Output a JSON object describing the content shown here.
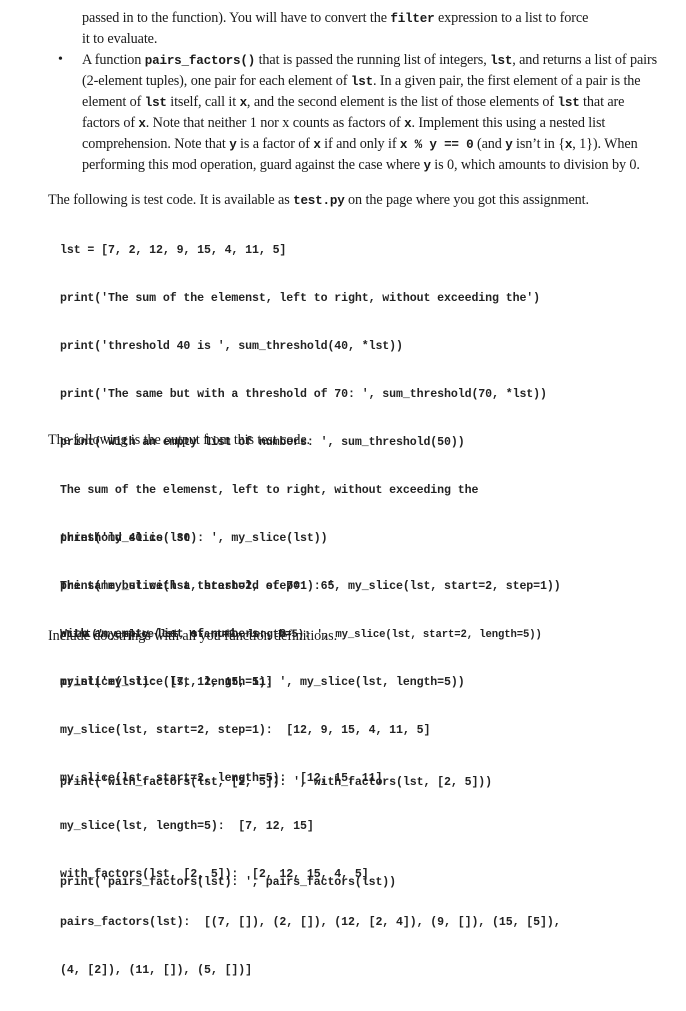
{
  "intro_continuation": {
    "line1_before": "passed in to the function). You will have to convert the ",
    "line1_code": "filter",
    "line1_after": " expression to a list to force",
    "line2": "it to evaluate."
  },
  "bullet": {
    "dot": "•",
    "seg1": "A function ",
    "seg1_code": "pairs_factors()",
    "seg2": " that is passed the running list of integers, ",
    "seg2_code": "lst",
    "seg3": ", and returns a list of pairs (2-element tuples), one pair for each element of ",
    "seg3_code": "lst",
    "seg4": ". In a given pair, the first element of a pair is the element of ",
    "seg4_code": "lst",
    "seg5": " itself, call it ",
    "seg5_code": "x",
    "seg6": ", and the second element is the list of those elements of ",
    "seg6_code": "lst",
    "seg7": " that are factors of ",
    "seg7_code": "x",
    "seg8": ". Note that neither 1 nor x counts as factors of ",
    "seg8_code": "x",
    "seg9": ". Implement this using a nested list comprehension. Note that ",
    "seg9_code": "y",
    "seg10": " is a factor of ",
    "seg10_code": "x",
    "seg11": " if and only if ",
    "seg11_code": "x % y == 0",
    "seg12": " (and ",
    "seg12_code": "y",
    "seg13": " isn’t in {",
    "seg13_code": "x",
    "seg14": ", 1}). When performing this mod operation, guard against the case where ",
    "seg14_code": "y",
    "seg15": " is 0, which amounts to division by 0."
  },
  "test_code_intro": {
    "before": "The following is test code. It is available as ",
    "code": "test.py",
    "after": " on the page where you got this assignment."
  },
  "test_code_lines": [
    "lst = [7, 2, 12, 9, 15, 4, 11, 5]",
    "print('The sum of the elemenst, left to right, without exceeding the')",
    "print('threshold 40 is ', sum_threshold(40, *lst))",
    "print('The same but with a threshold of 70: ', sum_threshold(70, *lst))",
    "print('With an empty list of numbers: ', sum_threshold(50))",
    "",
    "print('my_slice(lst): ', my_slice(lst))",
    "print('my_slice(lst, start=2, step=1): ', my_slice(lst, start=2, step=1))",
    "print('my_slice(lst, start=2, length=5): ', my_slice(lst, start=2, length=5))",
    "print('my_slice(lst, length=5): ', my_slice(lst, length=5))",
    "",
    "print('with_factors(lst, [2, 5]): ', with_factors(lst, [2, 5]))",
    "",
    "print('pairs_factors(lst): ', pairs_factors(lst))"
  ],
  "output_intro": "The following is the output from this test code.",
  "output_lines": [
    "The sum of the elemenst, left to right, without exceeding the",
    "threshold 40 is  30",
    "The same but with a threshold of 70:  65",
    "With an empty list of numbers:  0",
    "my_slice(lst):  [7, 12, 15, 11]",
    "my_slice(lst, start=2, step=1):  [12, 9, 15, 4, 11, 5]",
    "my_slice(lst, start=2, length=5):  [12, 15, 11]",
    "my_slice(lst, length=5):  [7, 12, 15]",
    "with_factors(lst, [2, 5]):  [2, 12, 15, 4, 5]",
    "pairs_factors(lst):  [(7, []), (2, []), (12, [2, 4]), (9, []), (15, [5]),",
    "(4, [2]), (11, []), (5, [])]"
  ],
  "closing": "Include docstrings with all you function definitions."
}
